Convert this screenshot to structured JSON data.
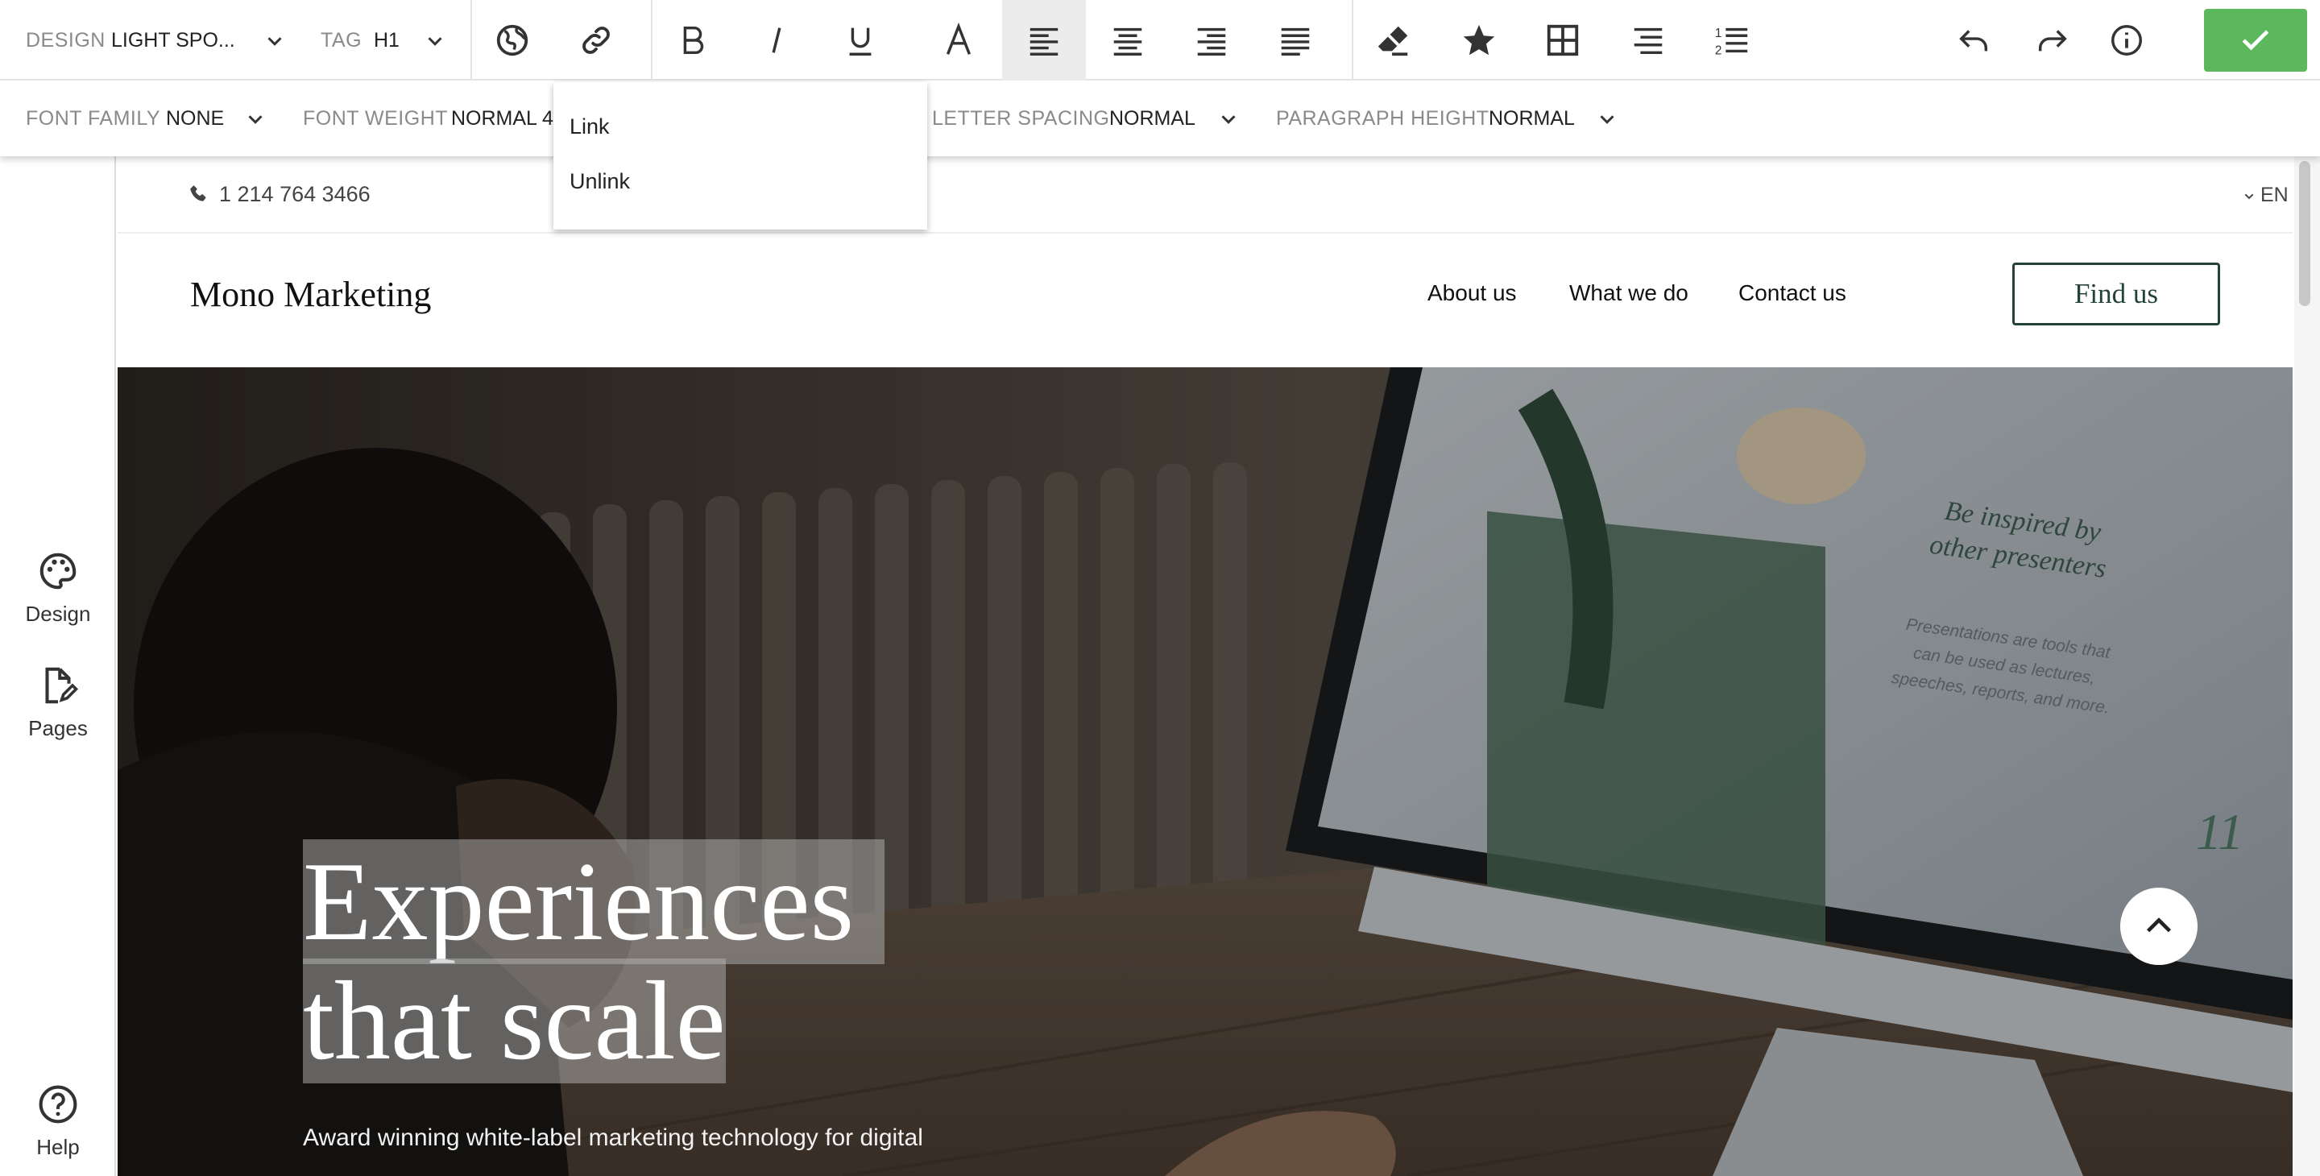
{
  "toolbar": {
    "design_label": "DESIGN",
    "design_value": "LIGHT SPO...",
    "tag_label": "TAG",
    "tag_value": "H1"
  },
  "text_toolbar": {
    "font_family_label": "FONT FAMILY",
    "font_family_value": "NONE",
    "font_weight_label": "FONT WEIGHT",
    "font_weight_value": "NORMAL 4",
    "letter_spacing_label": "LETTER SPACING",
    "letter_spacing_value": "NORMAL",
    "paragraph_height_label": "PARAGRAPH HEIGHT",
    "paragraph_height_value": "NORMAL"
  },
  "link_menu": {
    "items": [
      "Link",
      "Unlink"
    ]
  },
  "left_rail": {
    "design": "Design",
    "pages": "Pages",
    "help": "Help"
  },
  "site": {
    "phone": "1 214 764 3466",
    "language": "EN",
    "brand": "Mono Marketing",
    "nav": [
      "About us",
      "What we do",
      "Contact us"
    ],
    "cta": "Find us",
    "hero_title_line1": "Experiences",
    "hero_title_line2": "that scale",
    "hero_subtitle": "Award winning white-label marketing technology for digital",
    "screen_heading_line1": "Be inspired by",
    "screen_heading_line2": "other presenters",
    "screen_text_line1": "Presentations are tools that",
    "screen_text_line2": "can be used as lectures,",
    "screen_text_line3": "speeches, reports, and more.",
    "screen_page_number": "11"
  },
  "colors": {
    "accent_green": "#5cb85c",
    "cta_border": "#23433a",
    "selection": "rgba(190,190,190,0.45)"
  }
}
